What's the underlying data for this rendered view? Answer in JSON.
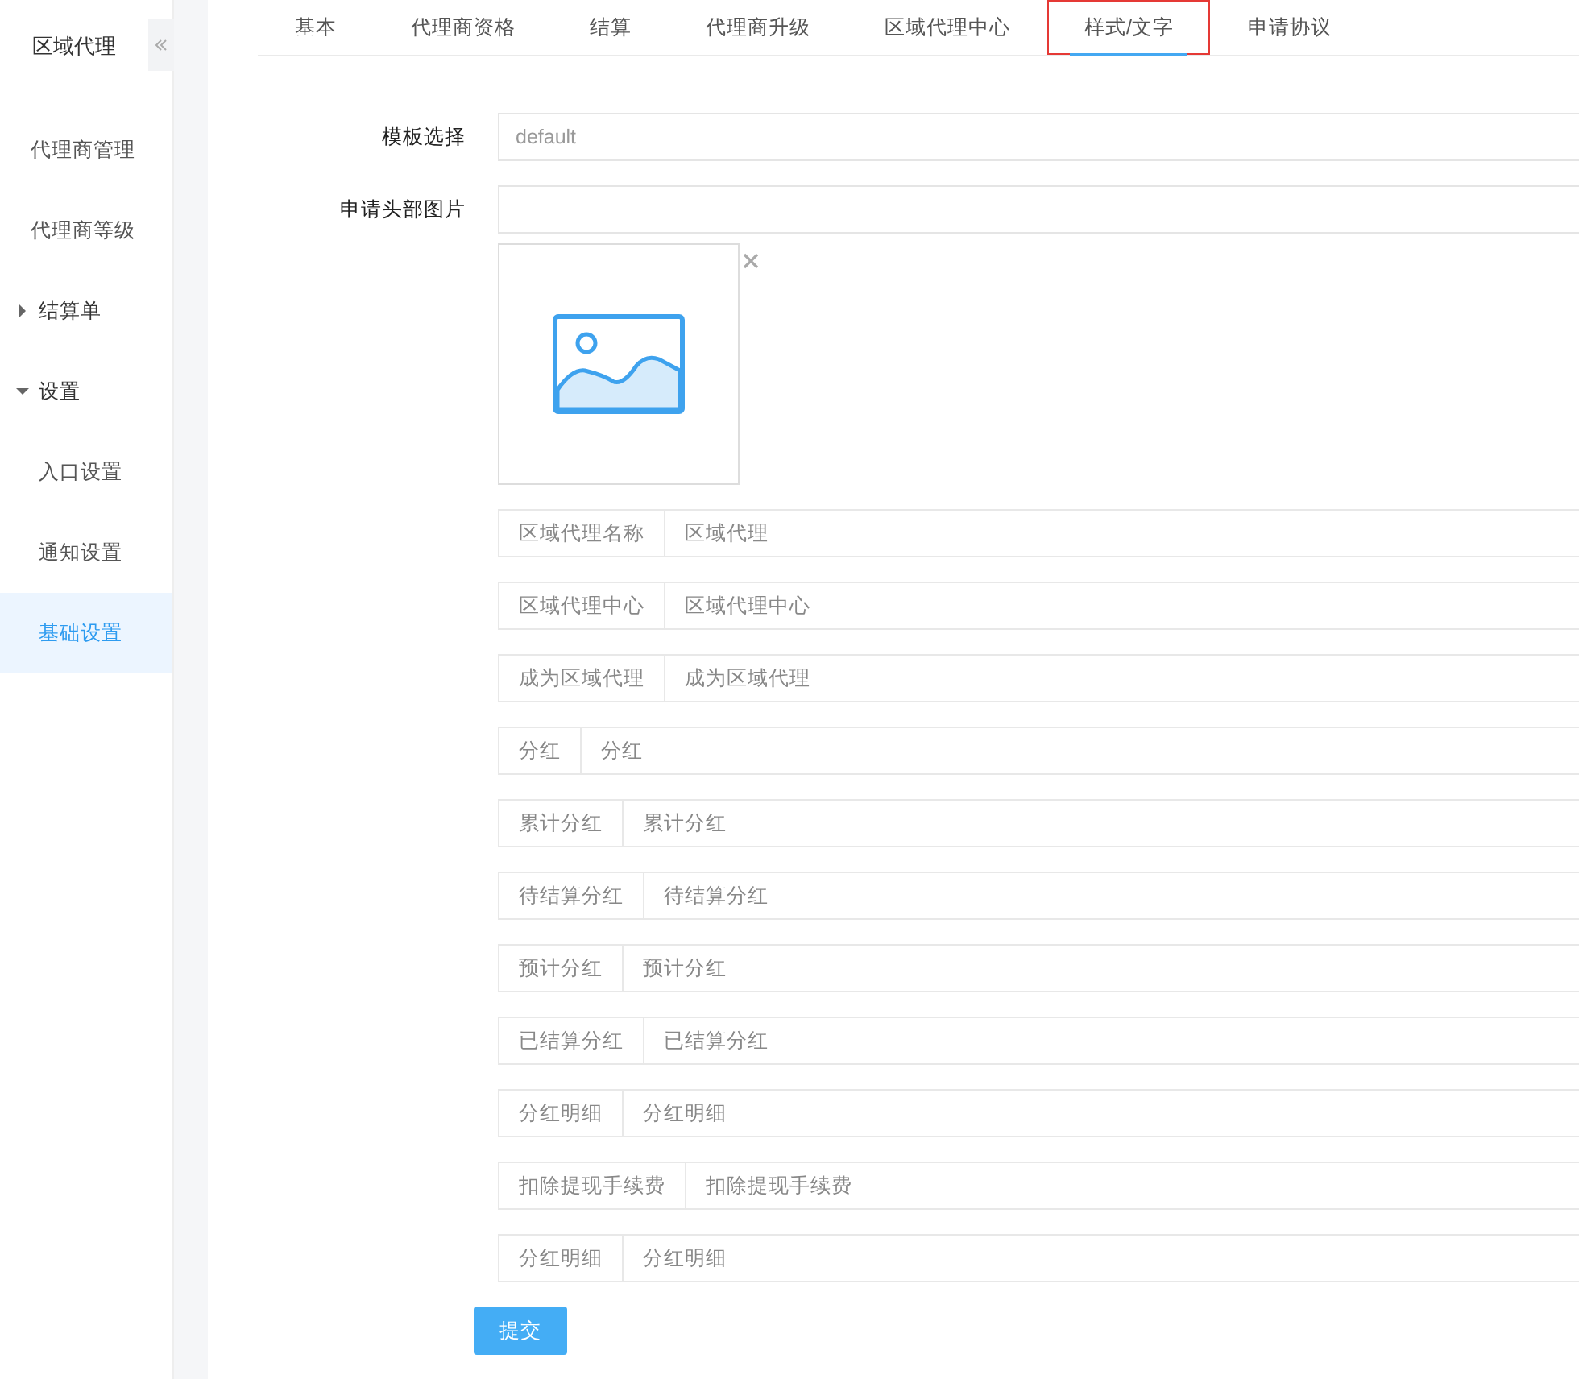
{
  "sidebar": {
    "title": "区域代理",
    "items": [
      {
        "kind": "link",
        "label": "代理商管理",
        "selected": false
      },
      {
        "kind": "link",
        "label": "代理商等级",
        "selected": false
      },
      {
        "kind": "group",
        "label": "结算单",
        "expanded": false
      },
      {
        "kind": "group",
        "label": "设置",
        "expanded": true,
        "children": [
          {
            "kind": "link",
            "label": "入口设置",
            "selected": false
          },
          {
            "kind": "link",
            "label": "通知设置",
            "selected": false
          },
          {
            "kind": "link",
            "label": "基础设置",
            "selected": true
          }
        ]
      }
    ]
  },
  "tabs": [
    {
      "label": "基本",
      "selected": false,
      "outlined": false
    },
    {
      "label": "代理商资格",
      "selected": false,
      "outlined": false
    },
    {
      "label": "结算",
      "selected": false,
      "outlined": false
    },
    {
      "label": "代理商升级",
      "selected": false,
      "outlined": false
    },
    {
      "label": "区域代理中心",
      "selected": false,
      "outlined": false
    },
    {
      "label": "样式/文字",
      "selected": true,
      "outlined": true
    },
    {
      "label": "申请协议",
      "selected": false,
      "outlined": false
    }
  ],
  "form": {
    "template": {
      "label": "模板选择",
      "value": "default"
    },
    "header_image": {
      "label": "申请头部图片"
    },
    "texts": [
      {
        "addon": "区域代理名称",
        "value": "区域代理"
      },
      {
        "addon": "区域代理中心",
        "value": "区域代理中心"
      },
      {
        "addon": "成为区域代理",
        "value": "成为区域代理"
      },
      {
        "addon": "分红",
        "value": "分红"
      },
      {
        "addon": "累计分红",
        "value": "累计分红"
      },
      {
        "addon": "待结算分红",
        "value": "待结算分红"
      },
      {
        "addon": "预计分红",
        "value": "预计分红"
      },
      {
        "addon": "已结算分红",
        "value": "已结算分红"
      },
      {
        "addon": "分红明细",
        "value": "分红明细"
      },
      {
        "addon": "扣除提现手续费",
        "value": "扣除提现手续费"
      },
      {
        "addon": "分红明细",
        "value": "分红明细"
      }
    ],
    "submit": "提交"
  }
}
